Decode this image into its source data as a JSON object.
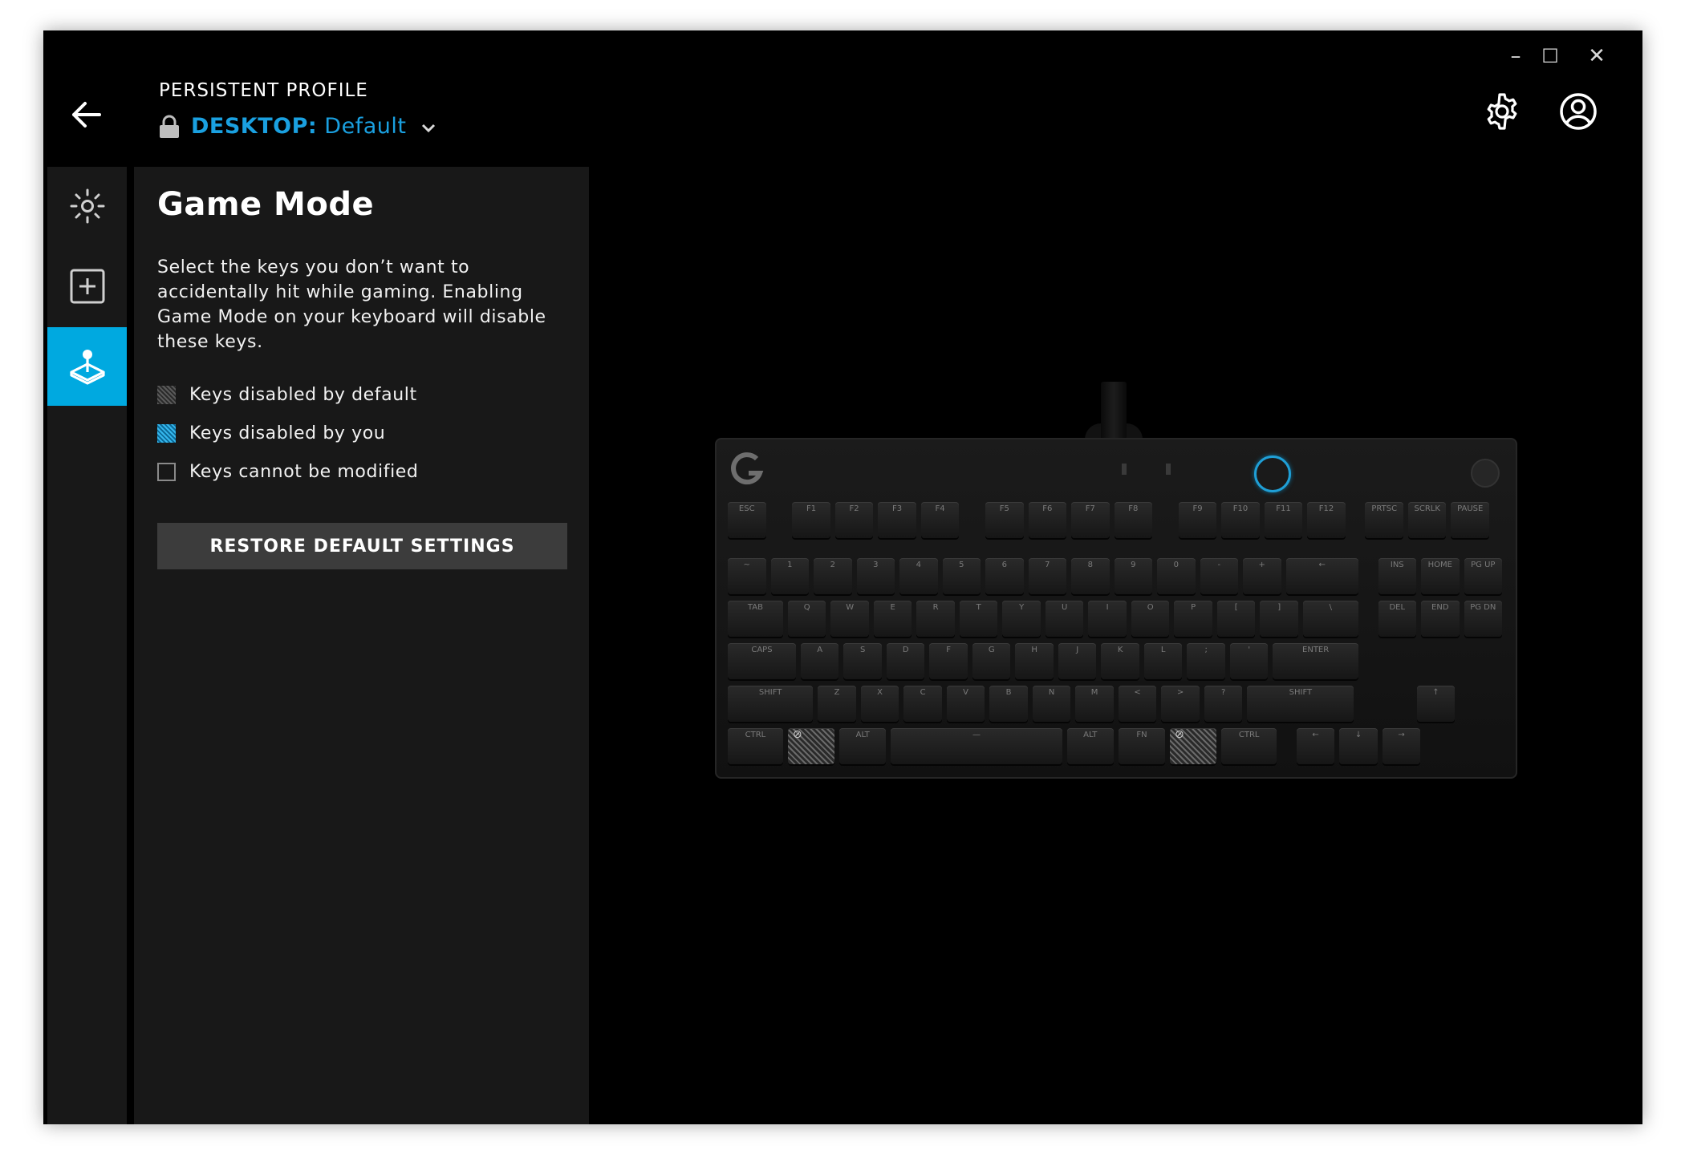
{
  "window": {
    "minimize_glyph": "–",
    "maximize_glyph": "☐",
    "close_glyph": "✕"
  },
  "header": {
    "profile_label": "PERSISTENT PROFILE",
    "profile_type": "DESKTOP:",
    "profile_name": "Default",
    "icons": [
      "back-arrow-icon",
      "lock-icon",
      "chevron-down-icon",
      "settings-gear-icon",
      "account-icon"
    ]
  },
  "sidebar": {
    "items": [
      {
        "name": "lighting",
        "icon": "sun-icon",
        "active": false
      },
      {
        "name": "assignments",
        "icon": "plus-square-icon",
        "active": false
      },
      {
        "name": "game-mode",
        "icon": "joystick-icon",
        "active": true
      }
    ]
  },
  "panel": {
    "title": "Game Mode",
    "description": "Select the keys you don’t want to accidentally hit while gaming. Enabling Game Mode on your keyboard will disable these keys.",
    "legend": [
      {
        "label": "Keys disabled by default"
      },
      {
        "label": "Keys disabled by you"
      },
      {
        "label": "Keys cannot be modified"
      }
    ],
    "restore_button": "RESTORE DEFAULT SETTINGS"
  },
  "colors": {
    "accent": "#00a9e0",
    "profile_text": "#1aa0e0",
    "background": "#000000",
    "panel": "#181818"
  },
  "keyboard": {
    "rows": [
      [
        "ESC",
        "F1",
        "F2",
        "F3",
        "F4",
        "F5",
        "F6",
        "F7",
        "F8",
        "F9",
        "F10",
        "F11",
        "F12",
        "PRTSC",
        "SCRLK",
        "PAUSE"
      ],
      [
        "~",
        "1",
        "2",
        "3",
        "4",
        "5",
        "6",
        "7",
        "8",
        "9",
        "0",
        "-",
        "+",
        "←",
        "INS",
        "HOME",
        "PG UP"
      ],
      [
        "TAB",
        "Q",
        "W",
        "E",
        "R",
        "T",
        "Y",
        "U",
        "I",
        "O",
        "P",
        "[",
        "]",
        "\\",
        "DEL",
        "END",
        "PG DN"
      ],
      [
        "CAPS",
        "A",
        "S",
        "D",
        "F",
        "G",
        "H",
        "J",
        "K",
        "L",
        ";",
        "'",
        "ENTER"
      ],
      [
        "SHIFT",
        "Z",
        "X",
        "C",
        "V",
        "B",
        "N",
        "M",
        "<",
        ">",
        "?",
        "SHIFT",
        "↑"
      ],
      [
        "CTRL",
        "⊘",
        "ALT",
        "—",
        "ALT",
        "FN",
        "⊘",
        "CTRL",
        "←",
        "↓",
        "→"
      ]
    ],
    "disabled_by_default": [
      "⊘"
    ]
  }
}
